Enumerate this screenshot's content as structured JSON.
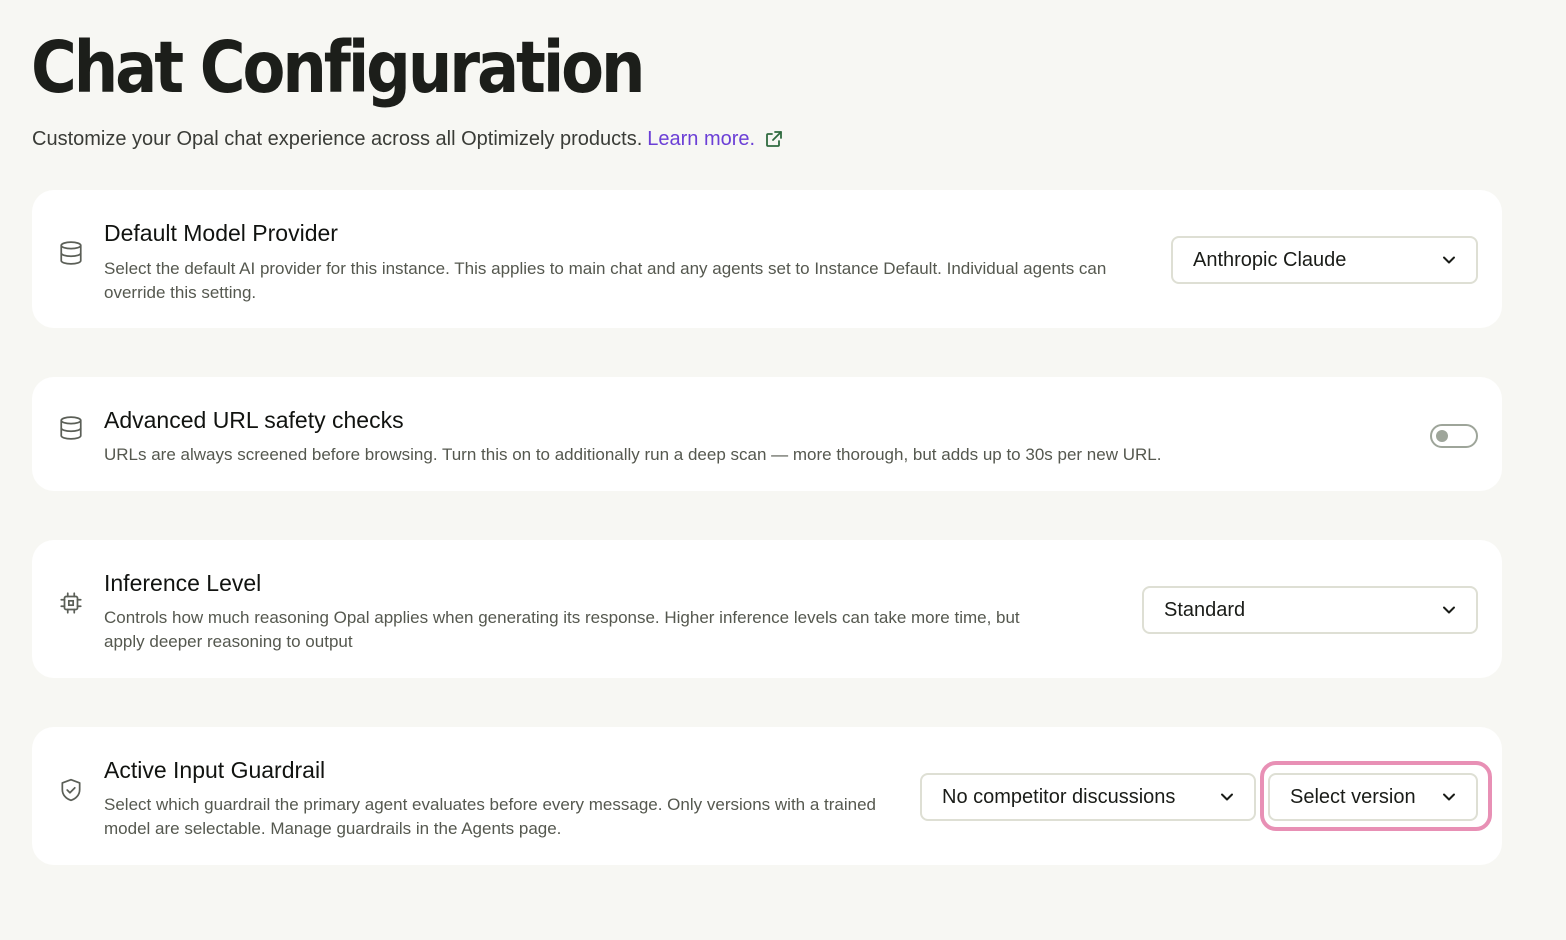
{
  "header": {
    "title": "Chat Configuration",
    "subtitle": "Customize your Opal chat experience across all Optimizely products.",
    "learn_more": "Learn more."
  },
  "settings": {
    "model_provider": {
      "title": "Default Model Provider",
      "description": "Select the default AI provider for this instance. This applies to main chat and any agents set to Instance Default. Individual agents can override this setting.",
      "selected": "Anthropic Claude"
    },
    "url_safety": {
      "title": "Advanced URL safety checks",
      "description": "URLs are always screened before browsing. Turn this on to additionally run a deep scan — more thorough, but adds up to 30s per new URL.",
      "enabled": false
    },
    "inference": {
      "title": "Inference Level",
      "description": "Controls how much reasoning Opal applies when generating its response. Higher inference levels can take more time, but apply deeper reasoning to output",
      "selected": "Standard"
    },
    "guardrail": {
      "title": "Active Input Guardrail",
      "description": "Select which guardrail the primary agent evaluates before every message. Only versions with a trained model are selectable. Manage guardrails in the Agents page.",
      "selected_guardrail": "No competitor discussions",
      "version_placeholder": "Select version"
    }
  },
  "icons": {
    "model_provider": "database-icon",
    "url_safety": "database-icon",
    "inference": "cpu-chip-icon",
    "guardrail": "shield-check-icon",
    "learn_more": "external-link-icon",
    "dropdown": "chevron-down-icon"
  },
  "colors": {
    "background": "#f7f7f3",
    "card": "#ffffff",
    "link": "#6b3fd6",
    "focus_ring": "#e890b5",
    "external_icon": "#2f6b3f"
  }
}
